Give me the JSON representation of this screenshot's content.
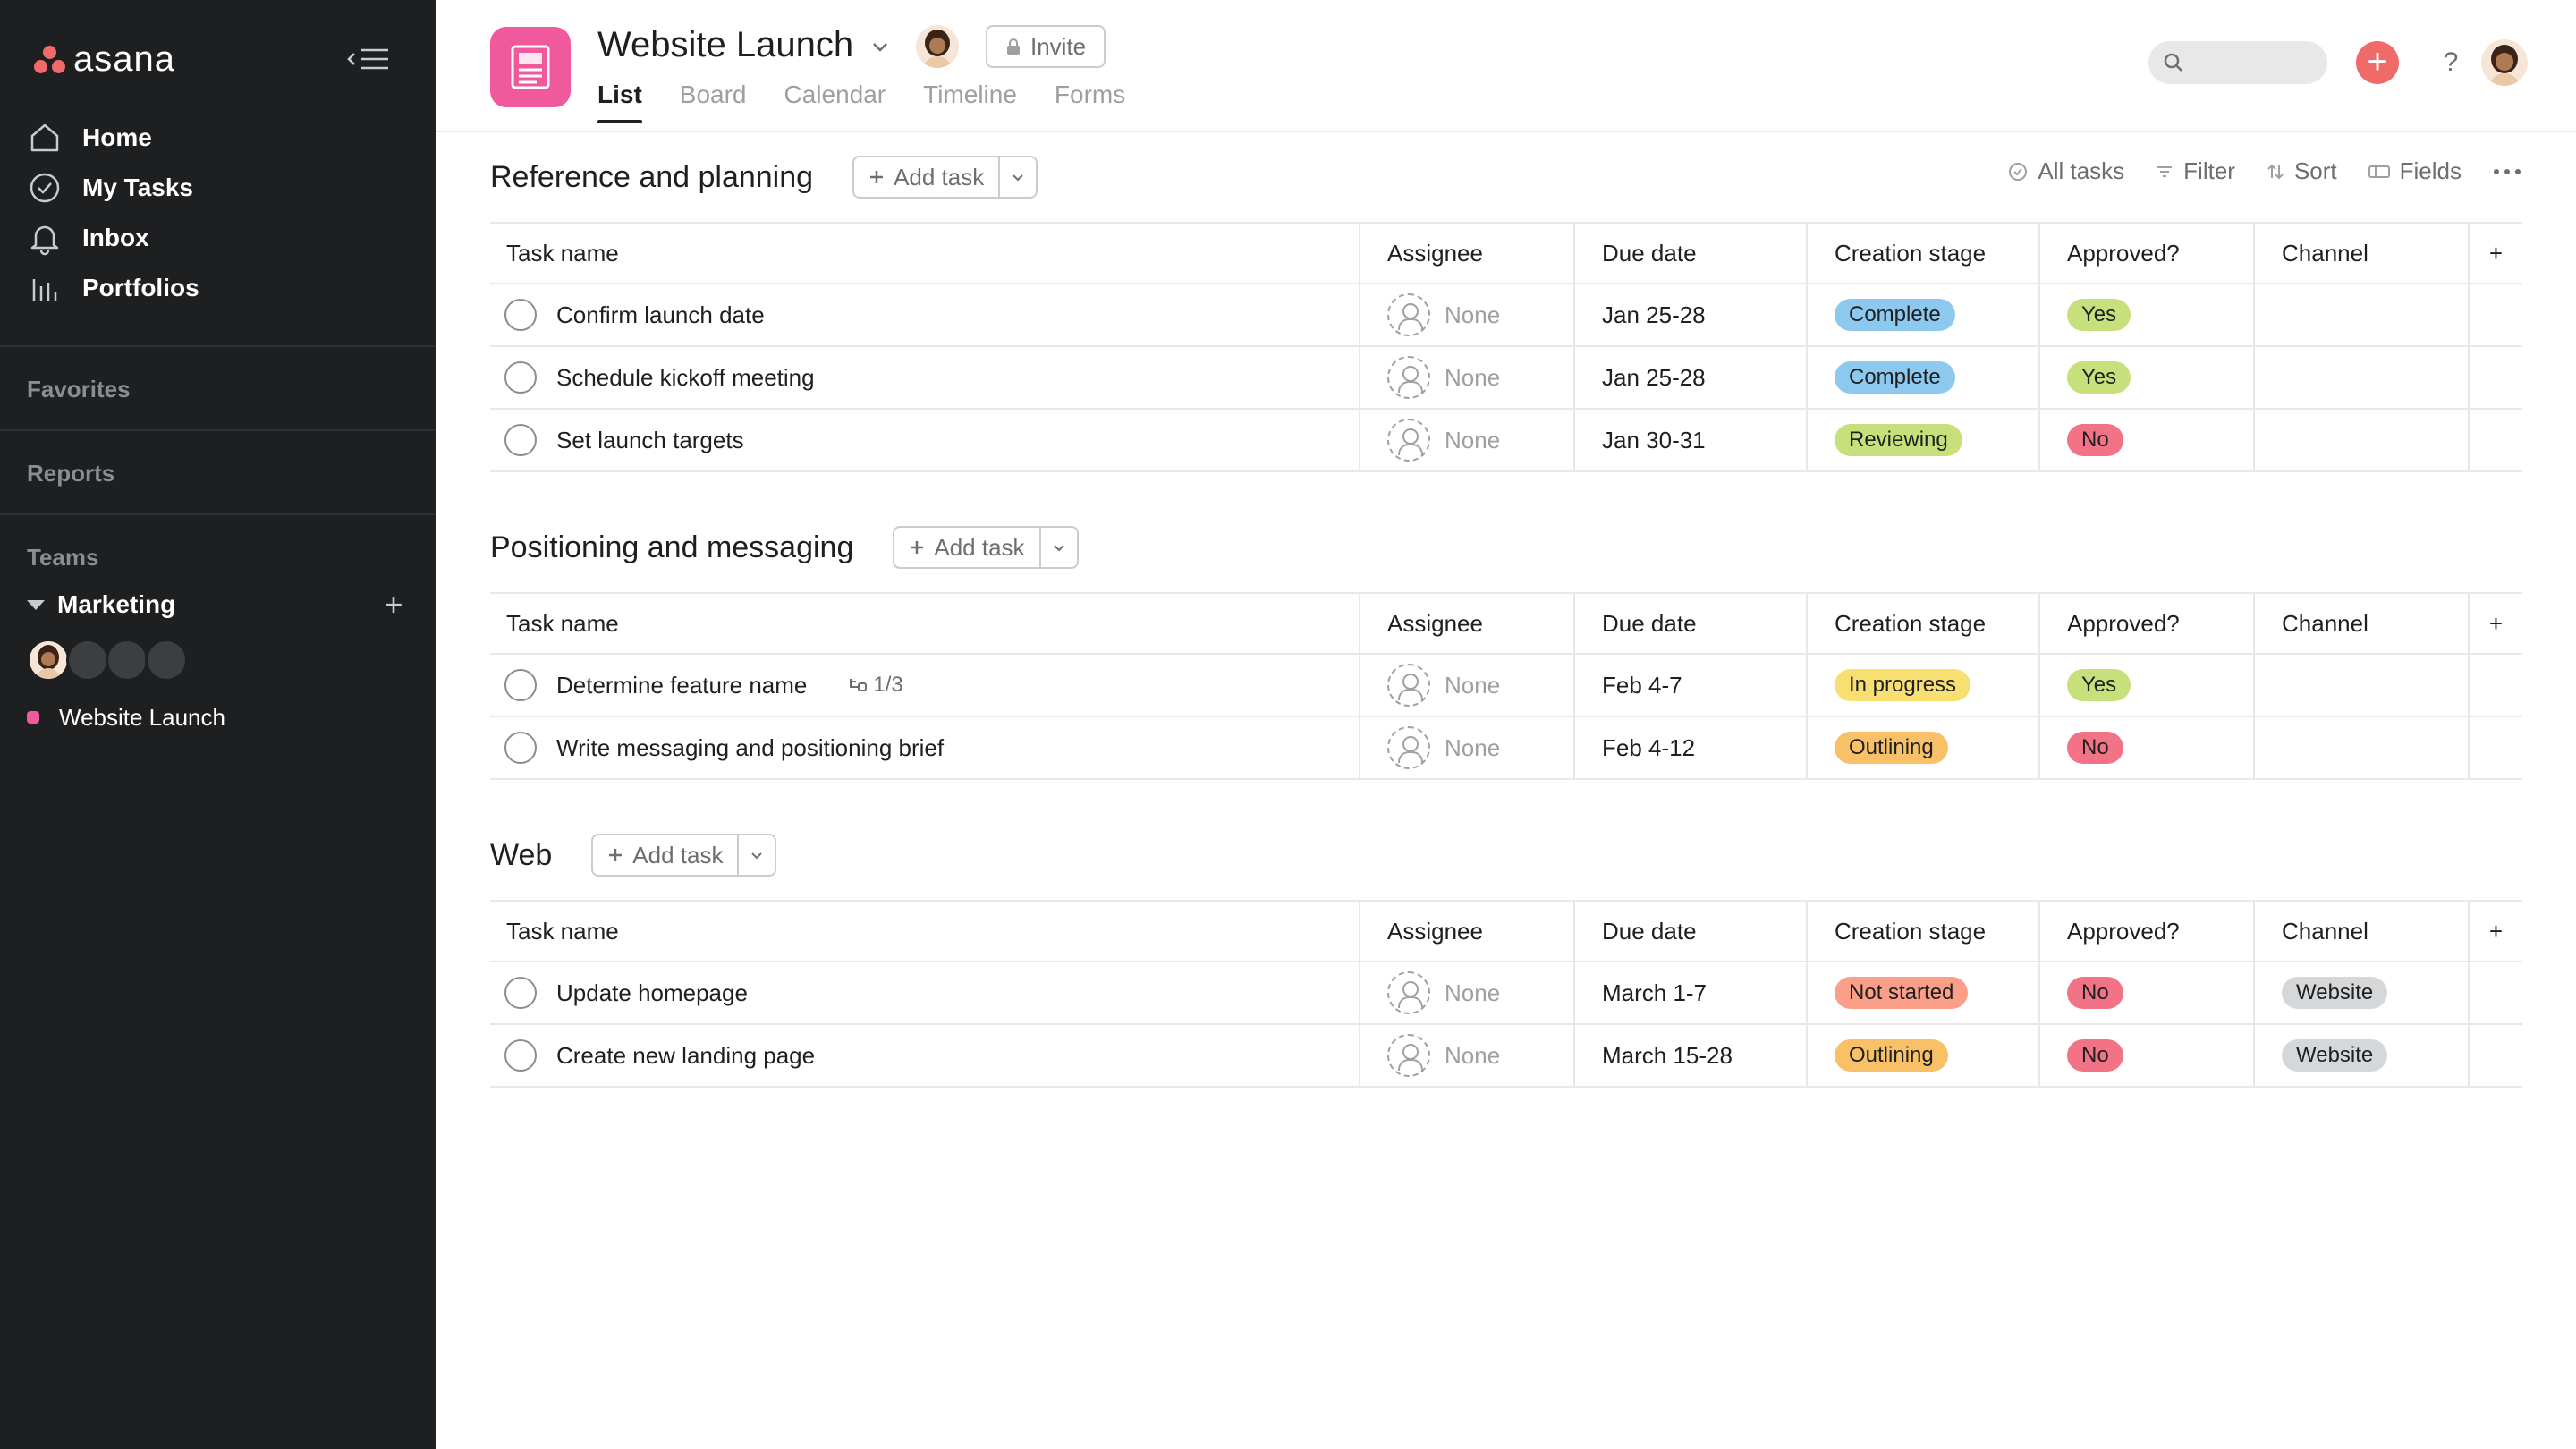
{
  "app": {
    "logo_text": "asana"
  },
  "sidebar": {
    "nav": [
      {
        "label": "Home",
        "icon": "home-icon"
      },
      {
        "label": "My Tasks",
        "icon": "check-circle-icon"
      },
      {
        "label": "Inbox",
        "icon": "bell-icon"
      },
      {
        "label": "Portfolios",
        "icon": "bar-chart-icon"
      }
    ],
    "favorites": "Favorites",
    "reports": "Reports",
    "teams": "Teams",
    "team_name": "Marketing",
    "project": "Website Launch"
  },
  "header": {
    "title": "Website Launch",
    "invite": "Invite",
    "tabs": [
      "List",
      "Board",
      "Calendar",
      "Timeline",
      "Forms"
    ],
    "active_tab": "List"
  },
  "toolbar": {
    "all_tasks": "All tasks",
    "filter": "Filter",
    "sort": "Sort",
    "fields": "Fields"
  },
  "columns": [
    "Task name",
    "Assignee",
    "Due date",
    "Creation stage",
    "Approved?",
    "Channel"
  ],
  "add_task_label": "Add task",
  "sections": [
    {
      "title": "Reference and planning",
      "tasks": [
        {
          "name": "Confirm launch date",
          "assignee": "None",
          "due": "Jan 25-28",
          "stage": "Complete",
          "approved": "Yes",
          "channel": ""
        },
        {
          "name": "Schedule kickoff meeting",
          "assignee": "None",
          "due": "Jan 25-28",
          "stage": "Complete",
          "approved": "Yes",
          "channel": ""
        },
        {
          "name": "Set launch targets",
          "assignee": "None",
          "due": "Jan 30-31",
          "stage": "Reviewing",
          "approved": "No",
          "channel": ""
        }
      ]
    },
    {
      "title": "Positioning and messaging",
      "tasks": [
        {
          "name": "Determine feature name",
          "subtasks": "1/3",
          "assignee": "None",
          "due": "Feb 4-7",
          "stage": "In progress",
          "approved": "Yes",
          "channel": ""
        },
        {
          "name": "Write messaging and positioning brief",
          "assignee": "None",
          "due": "Feb 4-12",
          "stage": "Outlining",
          "approved": "No",
          "channel": ""
        }
      ]
    },
    {
      "title": "Web",
      "tasks": [
        {
          "name": "Update homepage",
          "assignee": "None",
          "due": "March 1-7",
          "stage": "Not started",
          "approved": "No",
          "channel": "Website"
        },
        {
          "name": "Create new landing page",
          "assignee": "None",
          "due": "March 15-28",
          "stage": "Outlining",
          "approved": "No",
          "channel": "Website"
        }
      ]
    }
  ],
  "colors": {
    "sidebar_bg": "#1e1f21",
    "brand": "#f06a6a",
    "project": "#f1599d",
    "pill_complete": "#8dc8ee",
    "pill_reviewing": "#c7e07b",
    "pill_in_progress": "#f8df72",
    "pill_outlining": "#f8c067",
    "pill_not_started": "#fb9f88",
    "pill_yes": "#c7e07b",
    "pill_no": "#f27385",
    "pill_channel": "#d5d7d9"
  }
}
